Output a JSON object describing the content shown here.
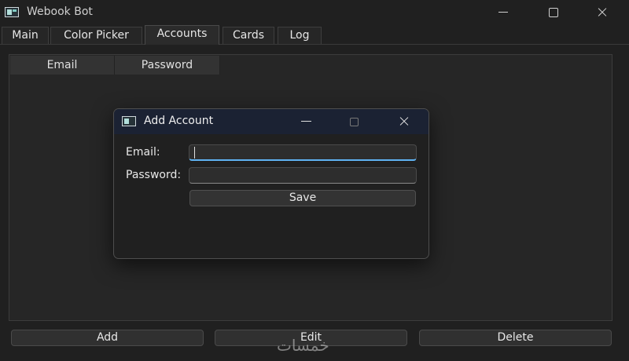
{
  "window": {
    "title": "Webook Bot"
  },
  "tabs": [
    {
      "label": "Main"
    },
    {
      "label": "Color Picker"
    },
    {
      "label": "Accounts"
    },
    {
      "label": "Cards"
    },
    {
      "label": "Log"
    }
  ],
  "active_tab": "Accounts",
  "accounts_table": {
    "columns": [
      "Email",
      "Password"
    ],
    "rows": []
  },
  "actions": {
    "add_label": "Add",
    "edit_label": "Edit",
    "delete_label": "Delete"
  },
  "dialog": {
    "title": "Add Account",
    "email_label": "Email:",
    "email_value": "",
    "password_label": "Password:",
    "password_value": "",
    "save_label": "Save"
  },
  "watermark": {
    "text": "خمسات"
  },
  "colors": {
    "background": "#202020",
    "dialog_titlebar": "#1b2233",
    "focus_accent": "#5fb2f2"
  },
  "icons": {
    "app": "app-window-icon",
    "minimize": "minimize-icon",
    "maximize": "maximize-icon",
    "close": "close-icon"
  }
}
